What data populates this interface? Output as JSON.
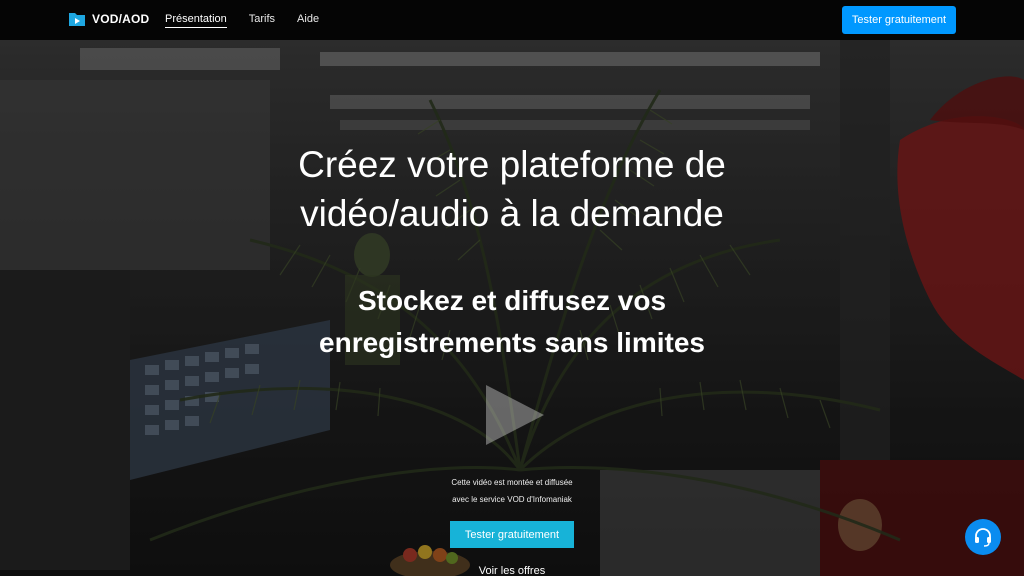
{
  "brand": {
    "name": "VOD/AOD",
    "icon": "video-folder-icon",
    "accent": "#0098ff"
  },
  "nav": {
    "items": [
      {
        "label": "Présentation",
        "active": true
      },
      {
        "label": "Tarifs",
        "active": false
      },
      {
        "label": "Aide",
        "active": false
      }
    ]
  },
  "header": {
    "cta_label": "Tester gratuitement"
  },
  "hero": {
    "headline_line1": "Créez votre plateforme de",
    "headline_line2": "vidéo/audio à la demande",
    "subhead_line1": "Stockez et diffusez vos",
    "subhead_line2": "enregistrements sans limites",
    "caption_line1": "Cette vidéo est montée et diffusée",
    "caption_line2": "avec le service VOD d'Infomaniak",
    "cta_label": "Tester gratuitement",
    "cta_color": "#17b3d8",
    "offers_link": "Voir les offres"
  },
  "support": {
    "icon": "headset-icon",
    "color": "#0a8cf0"
  }
}
